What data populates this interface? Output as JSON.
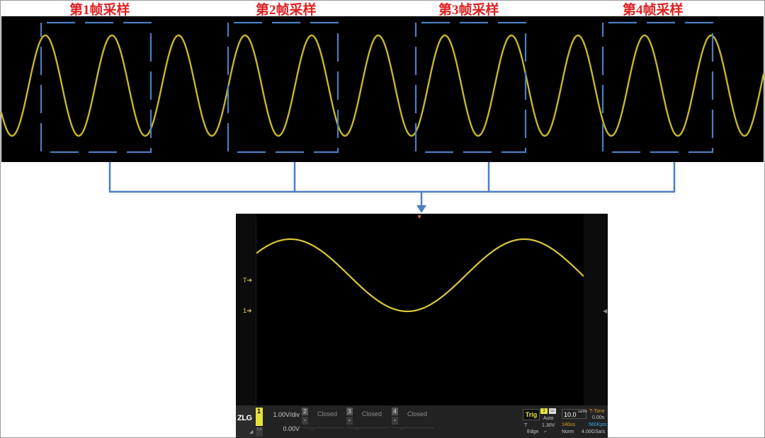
{
  "frames": {
    "labels": [
      "第1帧采样",
      "第2帧采样",
      "第3帧采样",
      "第4帧采样"
    ]
  },
  "colors": {
    "waveform": "#c7b62a",
    "bracket": "#4a7fc1",
    "label": "#e02020",
    "scope_trace": "#d8c83a"
  },
  "scope": {
    "markers": {
      "trigger": "T",
      "channel1": "1"
    },
    "logo": "ZLG",
    "ch1": {
      "number": "1",
      "scale": "1.00V/div",
      "offset": "0.00V",
      "sub": "1:1"
    },
    "channels": [
      {
        "number": "2",
        "status": "Closed",
        "dashes": "--"
      },
      {
        "number": "3",
        "status": "Closed",
        "dashes": "--"
      },
      {
        "number": "4",
        "status": "Closed",
        "dashes": "--"
      }
    ],
    "trigger": {
      "label": "Trig",
      "source": "1",
      "mode": "Auto",
      "t_label": "T",
      "level": "1.30V",
      "type": "Edge"
    },
    "timebase": {
      "scale": "10.0",
      "unit": "us/div",
      "t_label": "T-Time",
      "t_value": "0.00s",
      "delay": "140us",
      "frequency": "560Kpts",
      "acq_mode": "Norm",
      "sample_rate": "4.00GSa/s"
    }
  }
}
